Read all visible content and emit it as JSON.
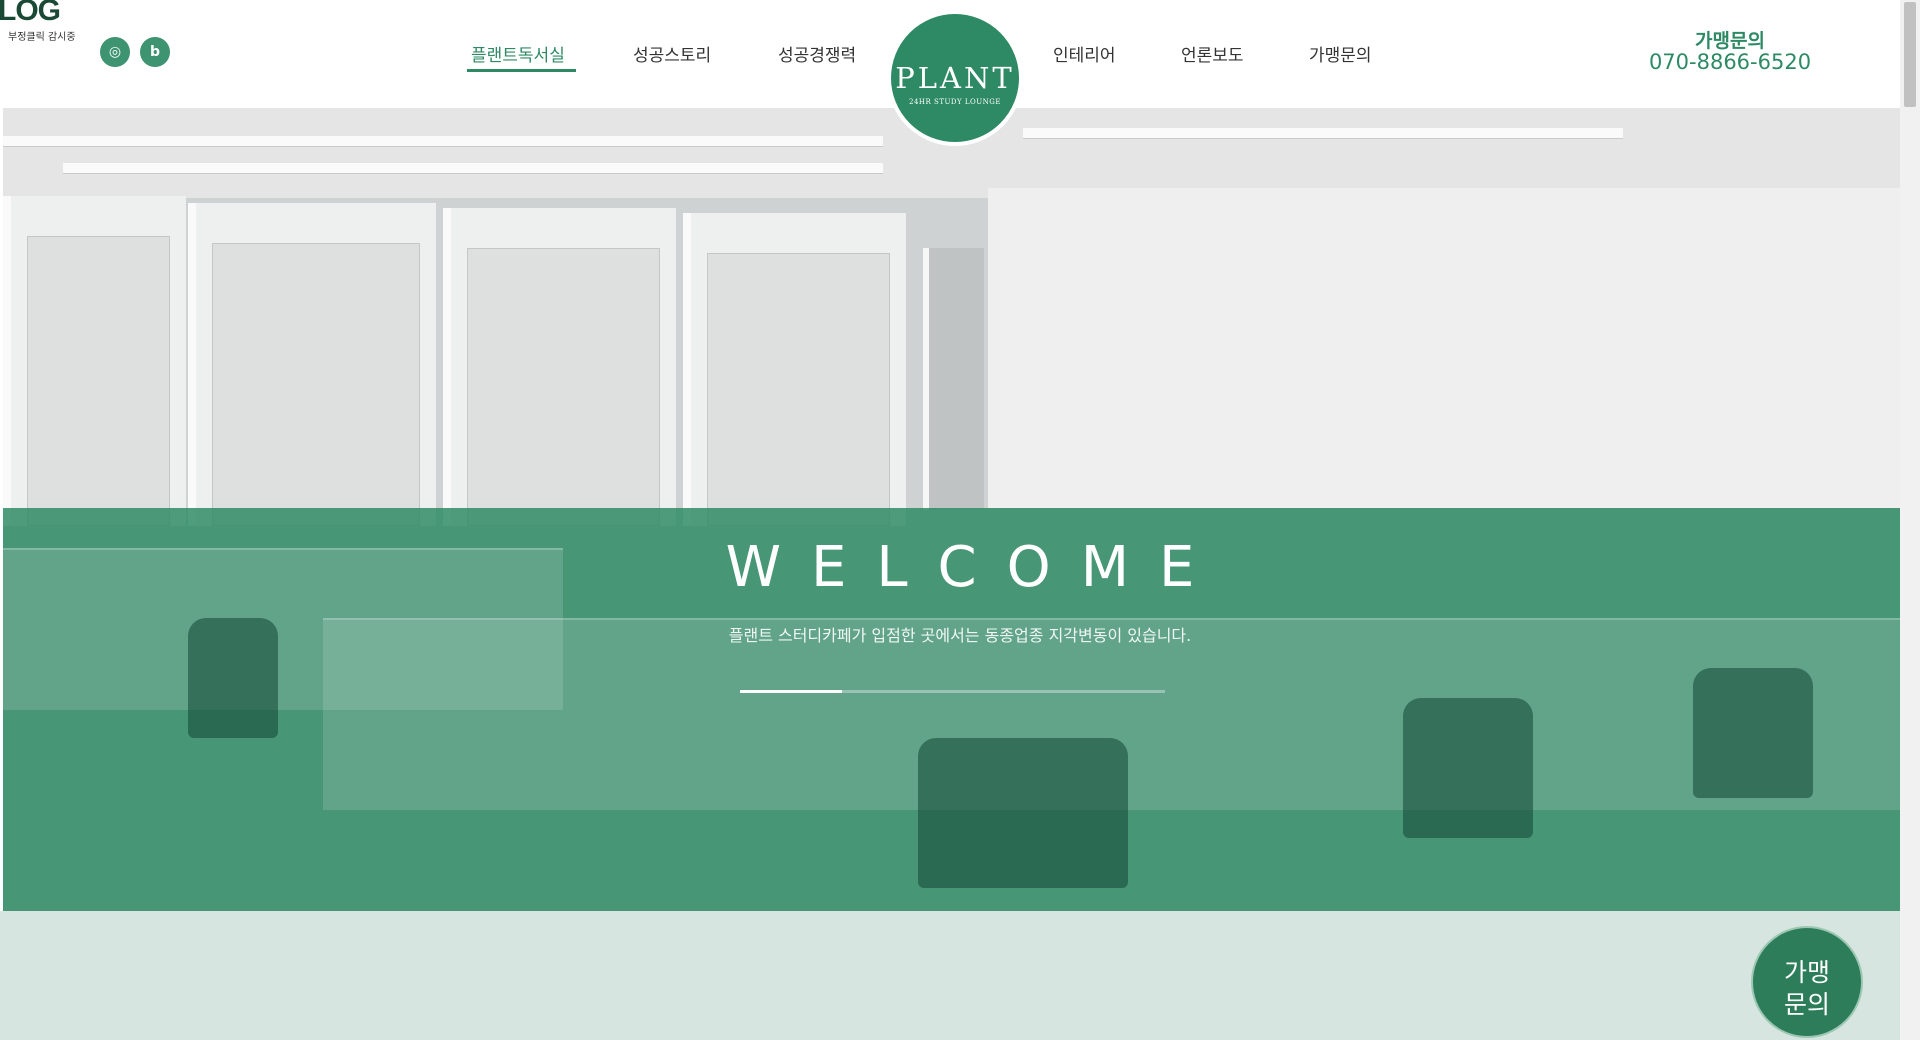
{
  "badge": {
    "text": "LOG",
    "sub": "부정클릭 감시중"
  },
  "social": [
    {
      "icon": "instagram-icon",
      "glyph": "◎"
    },
    {
      "icon": "blog-icon",
      "glyph": "b"
    }
  ],
  "nav": {
    "items": [
      {
        "label": "플랜트독서실",
        "active": true
      },
      {
        "label": "성공스토리"
      },
      {
        "label": "성공경쟁력"
      },
      {
        "label": "인테리어"
      },
      {
        "label": "언론보도"
      },
      {
        "label": "가맹문의"
      }
    ]
  },
  "logo": {
    "word": "PLANT",
    "tagline": "24HR STUDY LOUNGE"
  },
  "contact": {
    "label": "가맹문의",
    "phone": "070-8866-6520"
  },
  "hero": {
    "title": "WELCOME",
    "subtitle": "플랜트 스터디카페가 입점한 곳에서는 동종업종 지각변동이 있습니다.",
    "slide_progress": 0.24
  },
  "float_button": {
    "line1": "가맹",
    "line2": "문의"
  },
  "colors": {
    "brand_green": "#2d8a64",
    "lower_bg": "#d6e5df"
  }
}
